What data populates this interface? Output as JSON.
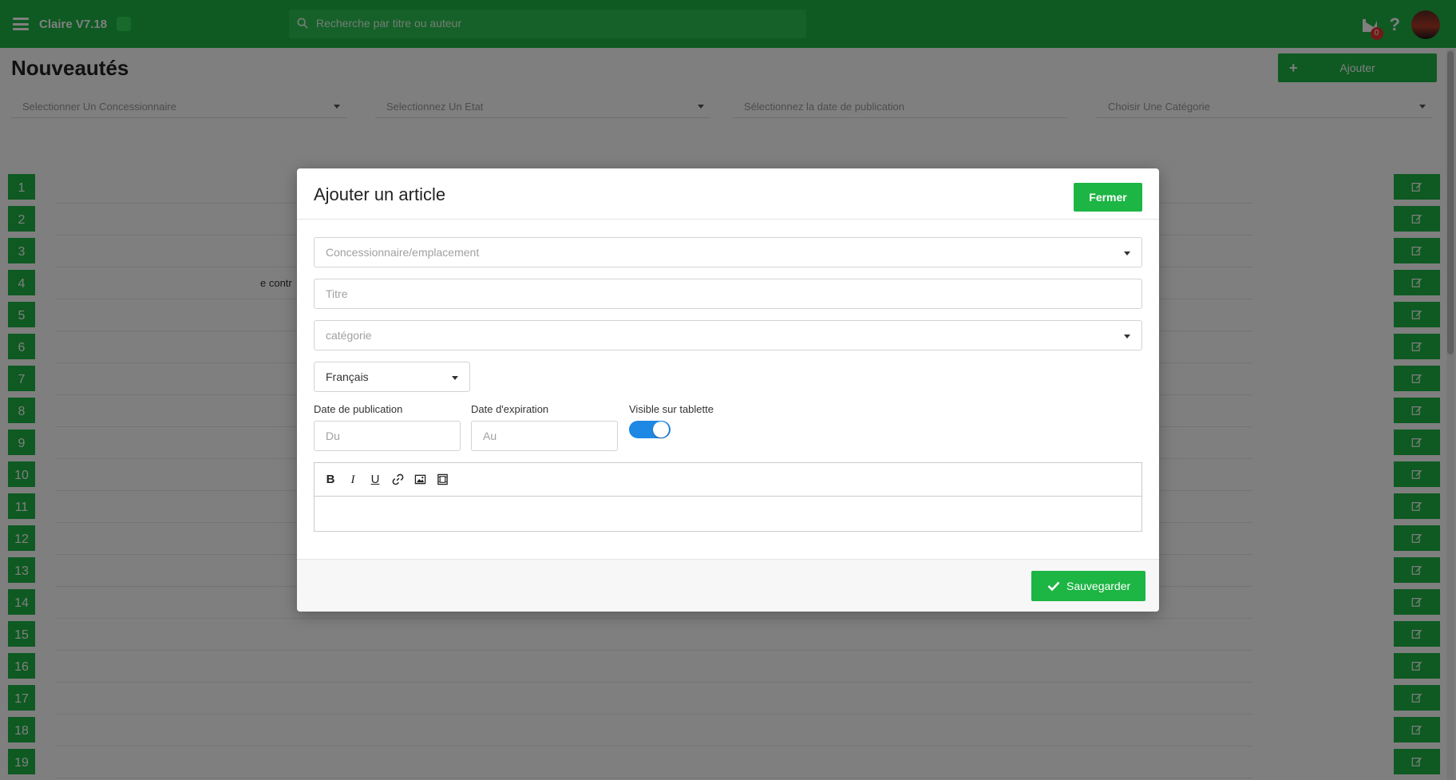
{
  "app": {
    "title": "Claire V7.18",
    "search_placeholder": "Recherche par titre ou auteur",
    "notifications_count": "0",
    "help_label": "?"
  },
  "page": {
    "title": "Nouveautés",
    "add_label": "Ajouter",
    "filters": [
      "Selectionner Un Concessionnaire",
      "Selectionnez Un Etat",
      "Sélectionnez la date de publication",
      "Choisir Une Catégorie"
    ],
    "row_numbers": [
      "1",
      "2",
      "3",
      "4",
      "5",
      "6",
      "7",
      "8",
      "9",
      "10",
      "11",
      "12",
      "13",
      "14",
      "15",
      "16",
      "17",
      "18",
      "19"
    ],
    "partial_text": "e contr"
  },
  "modal": {
    "title": "Ajouter un article",
    "close_label": "Fermer",
    "dealer_placeholder": "Concessionnaire/emplacement",
    "title_placeholder": "Titre",
    "category_placeholder": "catégorie",
    "language_value": "Français",
    "publication_date_label": "Date de publication",
    "publication_date_placeholder": "Du",
    "expiration_date_label": "Date d'expiration",
    "expiration_date_placeholder": "Au",
    "tablet_visible_label": "Visible sur tablette",
    "tablet_visible": true,
    "toolbar": {
      "bold": "B",
      "italic": "I",
      "underline": "U",
      "link_icon": "link-icon",
      "image_icon": "image-icon",
      "video_icon": "video-icon"
    },
    "save_label": "Sauvegarder"
  },
  "colors": {
    "brand_green": "#1db544",
    "toggle_blue": "#1e88e5",
    "badge_red": "#e3342f"
  }
}
